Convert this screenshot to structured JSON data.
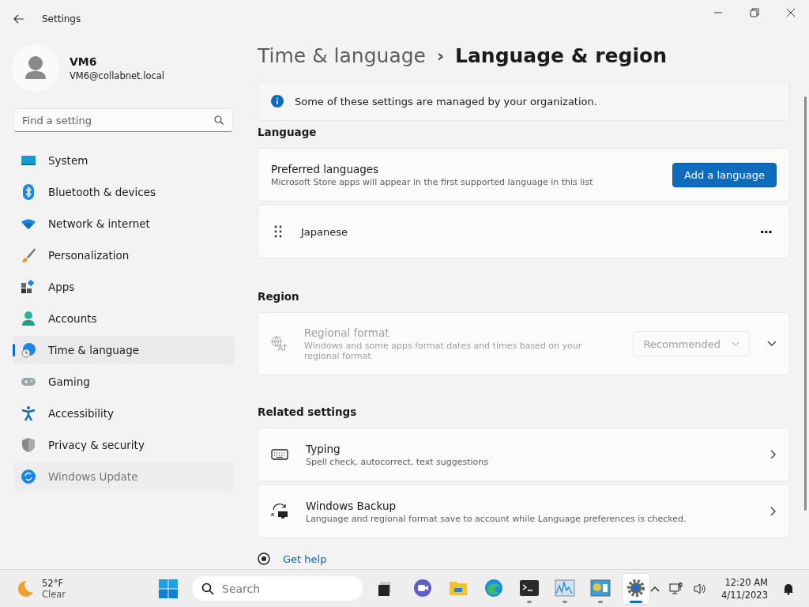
{
  "window": {
    "title": "Settings"
  },
  "user": {
    "name": "VM6",
    "email": "VM6@collabnet.local"
  },
  "search": {
    "placeholder": "Find a setting"
  },
  "nav": [
    {
      "kind": "system",
      "label": "System",
      "selected": false,
      "hovered": false
    },
    {
      "kind": "bluetooth",
      "label": "Bluetooth & devices",
      "selected": false,
      "hovered": false
    },
    {
      "kind": "network",
      "label": "Network & internet",
      "selected": false,
      "hovered": false
    },
    {
      "kind": "personalization",
      "label": "Personalization",
      "selected": false,
      "hovered": false
    },
    {
      "kind": "apps",
      "label": "Apps",
      "selected": false,
      "hovered": false
    },
    {
      "kind": "accounts",
      "label": "Accounts",
      "selected": false,
      "hovered": false
    },
    {
      "kind": "time",
      "label": "Time & language",
      "selected": true,
      "hovered": false
    },
    {
      "kind": "gaming",
      "label": "Gaming",
      "selected": false,
      "hovered": false
    },
    {
      "kind": "accessibility",
      "label": "Accessibility",
      "selected": false,
      "hovered": false
    },
    {
      "kind": "privacy",
      "label": "Privacy & security",
      "selected": false,
      "hovered": false
    },
    {
      "kind": "update",
      "label": "Windows Update",
      "selected": false,
      "hovered": true
    }
  ],
  "breadcrumb": {
    "parent": "Time & language",
    "separator": "›",
    "current": "Language & region"
  },
  "notice": "Some of these settings are managed by your organization.",
  "language": {
    "heading": "Language",
    "title": "Preferred languages",
    "description": "Microsoft Store apps will appear in the first supported language in this list",
    "button": "Add a language",
    "languages": [
      {
        "name": "Japanese",
        "more": "···"
      }
    ]
  },
  "region": {
    "heading": "Region",
    "title": "Regional format",
    "description": "Windows and some apps format dates and times based on your regional format",
    "value": "Recommended",
    "disabled": true
  },
  "related": {
    "heading": "Related settings",
    "items": [
      {
        "kind": "typing",
        "title": "Typing",
        "description": "Spell check, autocorrect, text suggestions"
      },
      {
        "kind": "backup",
        "title": "Windows Backup",
        "description": "Language and regional format save to account while Language preferences is checked."
      }
    ]
  },
  "help": "Get help",
  "taskbar": {
    "weather": {
      "temp": "52°F",
      "condition": "Clear"
    },
    "search": {
      "placeholder": "Search"
    },
    "apps": [
      {
        "kind": "taskview",
        "running": false,
        "selected": false
      },
      {
        "kind": "chat",
        "running": false,
        "selected": false
      },
      {
        "kind": "explorer",
        "running": false,
        "selected": false
      },
      {
        "kind": "edge",
        "running": false,
        "selected": false
      },
      {
        "kind": "terminal",
        "running": true,
        "selected": false
      },
      {
        "kind": "perfmon",
        "running": true,
        "selected": false
      },
      {
        "kind": "resmon",
        "running": true,
        "selected": false
      },
      {
        "kind": "settings",
        "running": true,
        "selected": true
      }
    ],
    "time": "12:20 AM",
    "date": "4/11/2023"
  }
}
